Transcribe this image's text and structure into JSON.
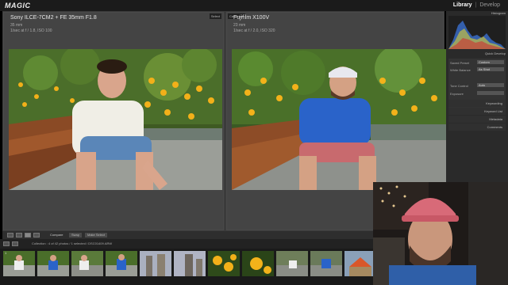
{
  "app": {
    "logo": "MAGIC",
    "modules": [
      "Library",
      "Develop"
    ],
    "active_module": "Library"
  },
  "compare": {
    "select": {
      "tag": "Select",
      "camera": "Sony ILCE-7CM2 + FE 35mm F1.8",
      "focal": "35 mm",
      "exposure": "1/sec at f / 1.8, ISO 100"
    },
    "candidate": {
      "tag": "Candidate",
      "camera": "Fujifilm X100V",
      "focal": "23 mm",
      "exposure": "1/sec at f / 2.0, ISO 320"
    }
  },
  "toolbar": {
    "compare_label": "Compare",
    "swap_label": "Swap",
    "make_select_label": "Make Select",
    "done_label": "Done"
  },
  "right_panel": {
    "histogram_title": "Histogram",
    "quick_develop_title": "Quick Develop",
    "saved_preset_label": "Saved Preset",
    "saved_preset_value": "Custom",
    "white_balance_label": "White Balance",
    "white_balance_value": "As Shot",
    "tone_control_label": "Tone Control",
    "tone_control_value": "Auto",
    "exposure_label": "Exposure",
    "sections": [
      "Keywording",
      "Keyword List",
      "Metadata",
      "Comments"
    ]
  },
  "filmstrip": {
    "path_text": "Collection : 4 of 42 photos / 1 selected / DSC01409.ARW",
    "selected_index": 1
  },
  "colors": {
    "accent": "#f0f0f0",
    "background": "#3b3b3b",
    "panel": "#2a2a2a"
  }
}
